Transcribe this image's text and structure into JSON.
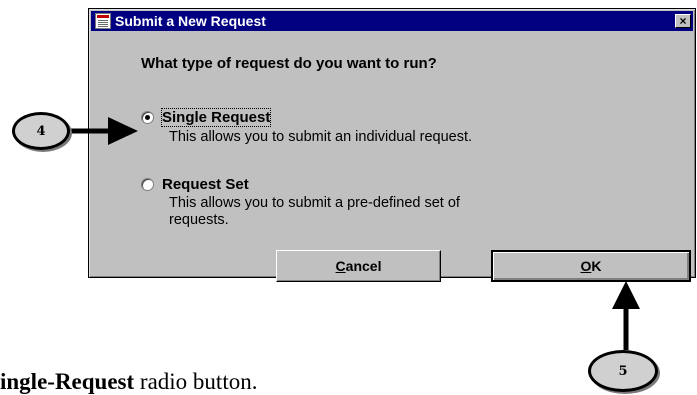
{
  "dialog": {
    "title": "Submit a New Request",
    "close_label": "×",
    "question": "What type of request do you want to run?",
    "options": [
      {
        "label": "Single Request",
        "description": "This allows you to submit an individual request.",
        "selected": true
      },
      {
        "label": "Request Set",
        "description_lines": [
          "This allows you to submit a pre-defined set of",
          "requests."
        ],
        "selected": false
      }
    ],
    "cancel_label": "ancel",
    "cancel_mnemonic": "C",
    "ok_label": "K",
    "ok_mnemonic": "O"
  },
  "callouts": {
    "step4": "4",
    "step5": "5"
  },
  "caption": {
    "bold": "ingle-Request",
    "rest": " radio button."
  }
}
